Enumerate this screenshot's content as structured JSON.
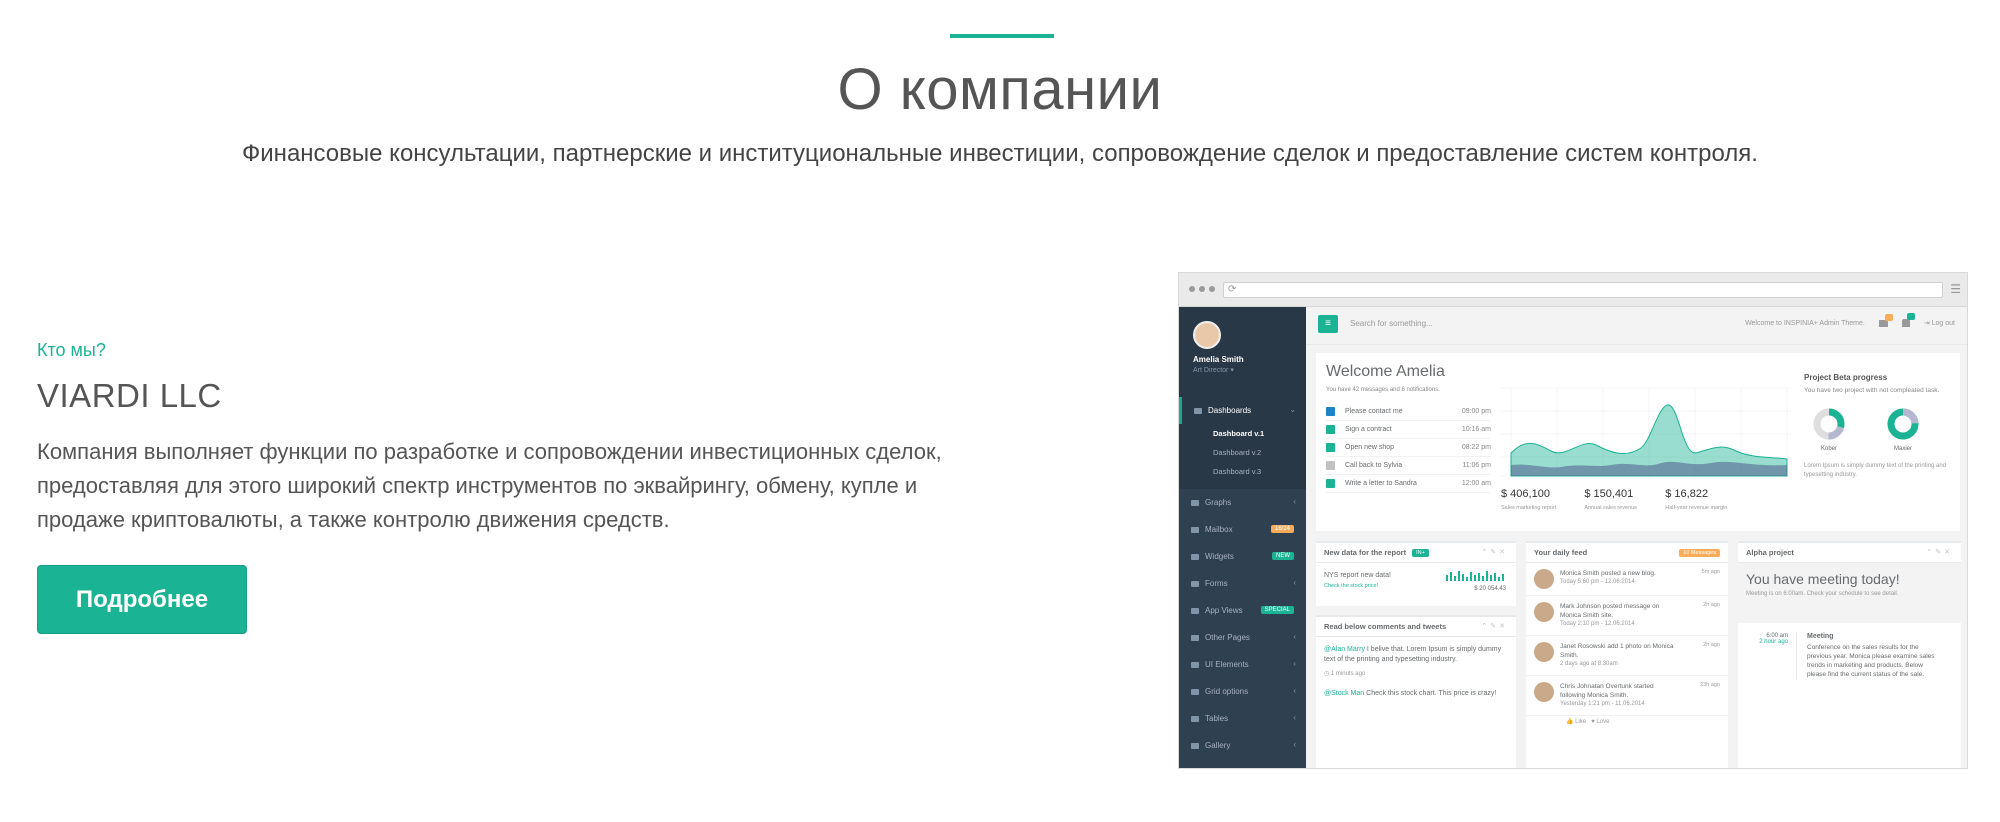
{
  "hero": {
    "title": "О компании",
    "subtitle": "Финансовые консультации, партнерские и институциональные инвестиции, сопровождение сделок и предоставление систем контроля."
  },
  "about": {
    "eyebrow": "Кто мы?",
    "company": "VIARDI LLC",
    "description": "Компания выполняет функции по разработке и сопровождении инвестиционных сделок, предоставляя для этого широкий спектр инструментов по эквайрингу, обмену, купле и продаже криптовалюты, а также контролю движения средств.",
    "cta_label": "Подробнее"
  },
  "colors": {
    "accent": "#1ab394",
    "sidebar": "#2f4050",
    "warning": "#f8ac59"
  },
  "mockup": {
    "user": {
      "name": "Amelia Smith",
      "role": "Art Director ▾"
    },
    "search_placeholder": "Search for something...",
    "top_welcome": "Welcome to INSPINIA+ Admin Theme.",
    "logout": "Log out",
    "nav": [
      {
        "label": "Dashboards",
        "active": true,
        "icon": "th-large-icon"
      },
      {
        "label": "Graphs",
        "icon": "bar-chart-icon"
      },
      {
        "label": "Mailbox",
        "badge": "16/24",
        "badge_color": "#f8ac59",
        "icon": "envelope-icon"
      },
      {
        "label": "Widgets",
        "badge": "NEW",
        "badge_color": "#1ab394",
        "icon": "flask-icon"
      },
      {
        "label": "Forms",
        "icon": "edit-icon"
      },
      {
        "label": "App Views",
        "badge": "SPECIAL",
        "badge_color": "#1ab394",
        "icon": "desktop-icon"
      },
      {
        "label": "Other Pages",
        "icon": "files-icon"
      },
      {
        "label": "UI Elements",
        "icon": "flask-icon"
      },
      {
        "label": "Grid options",
        "icon": "laptop-icon"
      },
      {
        "label": "Tables",
        "icon": "table-icon"
      },
      {
        "label": "Gallery",
        "icon": "picture-icon"
      }
    ],
    "subnav": [
      "Dashboard v.1",
      "Dashboard v.2",
      "Dashboard v.3"
    ],
    "welcome_title": "Welcome Amelia",
    "welcome_sub": "You have 42 messages and 6 notifications.",
    "tasks": [
      {
        "label": "Please contact me",
        "time": "09:00 pm",
        "color": "#1c84c6"
      },
      {
        "label": "Sign a contract",
        "time": "10:16 am",
        "color": "#1ab394"
      },
      {
        "label": "Open new shop",
        "time": "08:22 pm",
        "color": "#1ab394"
      },
      {
        "label": "Call back to Sylvia",
        "time": "11:06 pm",
        "color": "#c2c2c2"
      },
      {
        "label": "Write a letter to Sandra",
        "time": "12:00 am",
        "color": "#1ab394"
      }
    ],
    "stats": [
      {
        "value": "$ 406,100",
        "label": "Sales marketing report"
      },
      {
        "value": "$ 150,401",
        "label": "Annual sales revenue"
      },
      {
        "value": "$ 16,822",
        "label": "Half-year revenue margin"
      }
    ],
    "beta": {
      "title": "Project Beta progress",
      "desc": "You have two project with not compleated task.",
      "labels": [
        "Kober",
        "Maxier"
      ],
      "footer": "Lorem Ipsum is simply dummy text of the printing and typesetting industry."
    },
    "report": {
      "title": "New data for the report",
      "badge": "IN+",
      "item": "NYS report new data!",
      "link": "Check the stock price!",
      "value": "$ 20 054.43"
    },
    "comments": {
      "title": "Read below comments and tweets",
      "c1_user": "@Alan Marry",
      "c1_text": "I belive that. Lorem Ipsum is simply dummy text of the printing and typesetting industry.",
      "c1_time": "1 minuts ago",
      "c2_user": "@Stock Man",
      "c2_text": "Check this stock chart. This price is crazy!"
    },
    "feed": {
      "title": "Your daily feed",
      "badge": "10 Messages",
      "items": [
        {
          "text": "Monica Smith posted a new blog.",
          "time": "5m ago",
          "date": "Today 5:60 pm - 12.06.2014"
        },
        {
          "text": "Mark Johnson posted message on Monica Smith site.",
          "time": "2h ago",
          "date": "Today 2:10 pm - 12.06.2014"
        },
        {
          "text": "Janet Rosowski add 1 photo on Monica Smith.",
          "time": "2h ago",
          "date": "2 days ago at 8:30am"
        },
        {
          "text": "Chris Johnatan Overtunk started following Monica Smith.",
          "time": "23h ago",
          "date": "Yesterday 1:21 pm - 11.06.2014"
        }
      ],
      "like": "Like",
      "love": "Love"
    },
    "alpha": {
      "title": "Alpha project",
      "big": "You have meeting today!",
      "small": "Meeting is on 6:00am. Check your schedule to see detail.",
      "time": "6:00 am",
      "ago": "2 hour ago",
      "m_title": "Meeting",
      "m_text": "Conference on the sales results for the previous year. Monica please examine sales trends in marketing and products. Below please find the current status of the sale."
    }
  }
}
